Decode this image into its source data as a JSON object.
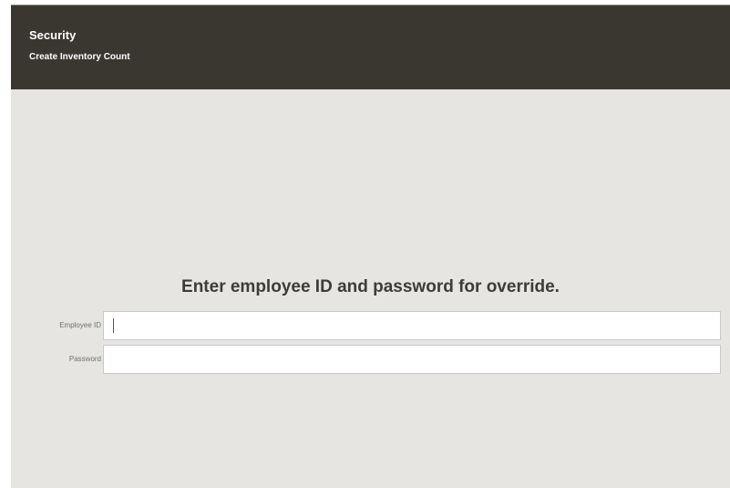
{
  "header": {
    "title": "Security",
    "subtitle": "Create Inventory Count"
  },
  "prompt": "Enter employee ID and password for override.",
  "form": {
    "employee_id": {
      "label": "Employee ID",
      "value": ""
    },
    "password": {
      "label": "Password",
      "value": ""
    }
  },
  "colors": {
    "header_bg": "#3a3730",
    "content_bg": "#e6e5e1",
    "header_text": "#ffffff",
    "prompt_text": "#3c3c3c"
  }
}
